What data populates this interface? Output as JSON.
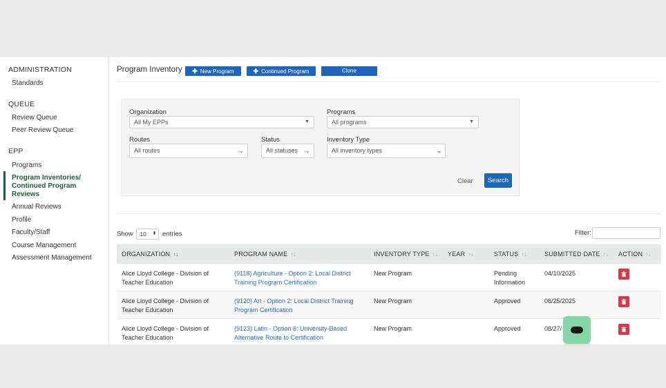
{
  "sidebar": {
    "sections": [
      {
        "title": "ADMINISTRATION",
        "items": [
          "Standards"
        ]
      },
      {
        "title": "QUEUE",
        "items": [
          "Review Queue",
          "Peer Review Queue"
        ]
      },
      {
        "title": "EPP",
        "items": [
          "Programs",
          "Program Inventories/ Continued Program Reviews",
          "Annual Reviews",
          "Profile",
          "Faculty/Staff",
          "Course Management",
          "Assessment Management"
        ]
      }
    ],
    "active_item": "Program Inventories/ Continued Program Reviews"
  },
  "header": {
    "title": "Program Inventory",
    "new_program": "New Program",
    "continued_program": "Continued Program",
    "clone": "Clone"
  },
  "filters": {
    "organization_label": "Organization",
    "organization_value": "All My EPPs",
    "programs_label": "Programs",
    "programs_value": "All programs",
    "routes_label": "Routes",
    "routes_value": "All routes",
    "status_label": "Status",
    "status_value": "All statuses",
    "inventory_type_label": "Inventory Type",
    "inventory_type_value": "All inventory types",
    "clear": "Clear",
    "search": "Search"
  },
  "table_controls": {
    "show": "Show",
    "entries_value": "10",
    "entries": "entries",
    "filter_label": "Filter:"
  },
  "table": {
    "columns": [
      "ORGANIZATION",
      "PROGRAM NAME",
      "INVENTORY TYPE",
      "YEAR",
      "STATUS",
      "SUBMITTED DATE",
      "ACTION"
    ],
    "rows": [
      {
        "organization": "Alice Lloyd College - Division of Teacher Education",
        "program": "(9118) Agriculture - Option 2: Local District Training Program Certification",
        "type": "New Program",
        "year": "",
        "status": "Pending Information",
        "date": "04/10/2025"
      },
      {
        "organization": "Alice Lloyd College - Division of Teacher Education",
        "program": "(9120) Art - Option 2: Local District Training Program Certification",
        "type": "New Program",
        "year": "",
        "status": "Approved",
        "date": "06/25/2025"
      },
      {
        "organization": "Alice Lloyd College - Division of Teacher Education",
        "program": "(9123) Latin - Option 6: University-Based Alternative Route to Certification",
        "type": "New Program",
        "year": "",
        "status": "Approved",
        "date": "08/27/"
      }
    ]
  },
  "colors": {
    "accent_green": "#1f5c3c",
    "primary_blue": "#2066b8",
    "link_blue": "#2a6cb4",
    "danger_red": "#dc3545",
    "chat_green": "#86d6a5"
  }
}
